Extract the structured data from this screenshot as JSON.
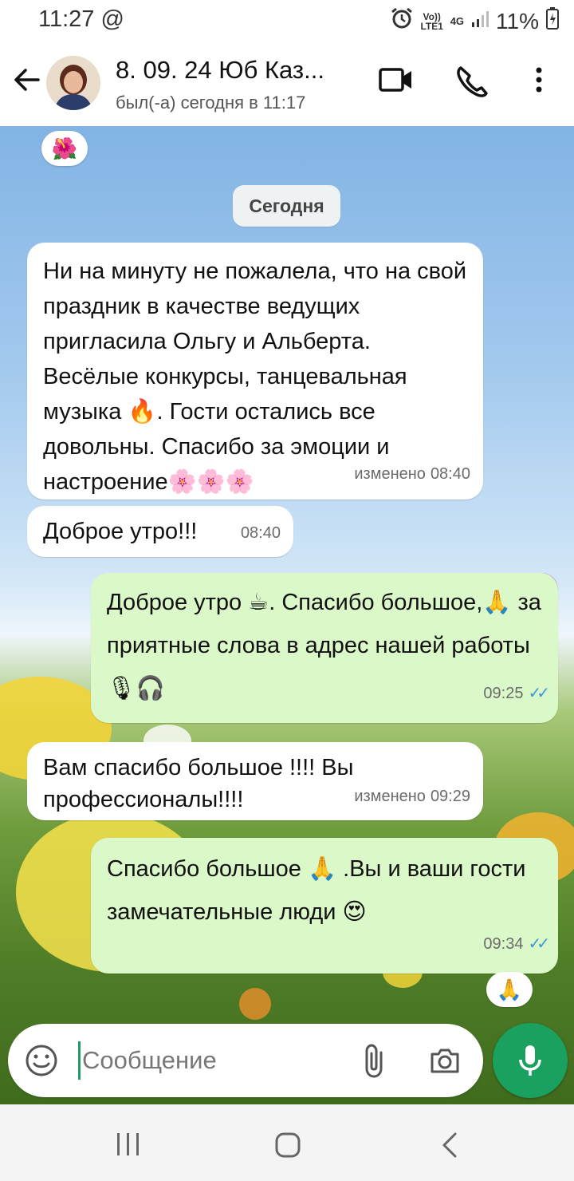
{
  "status_bar": {
    "time": "11:27",
    "at_symbol": "@",
    "volte": "Vo)) LTE1",
    "network": "4G",
    "battery": "11%"
  },
  "header": {
    "title": "8. 09. 24 Юб Каз...",
    "subtitle": "был(-а) сегодня в 11:17",
    "icons": [
      "back-arrow-icon",
      "video-call-icon",
      "phone-icon",
      "more-vert-icon"
    ]
  },
  "chat": {
    "top_reaction": "🌺",
    "day_chip": "Сегодня",
    "messages": [
      {
        "direction": "incoming",
        "text": "Ни на минуту не пожалела, что на свой праздник в качестве ведущих пригласила Ольгу и Альберта. Весёлые конкурсы, танцевальная музыка 🔥. Гости остались все довольны. Спасибо за эмоции и настроение🌸🌸🌸",
        "edited": "изменено",
        "time": "08:40"
      },
      {
        "direction": "incoming",
        "text": "Доброе утро!!!",
        "edited": "",
        "time": "08:40"
      },
      {
        "direction": "outgoing",
        "text": "Доброе утро ☕. Спасибо большое,🙏 за приятные слова в адрес нашей работы 🎙🎧",
        "edited": "",
        "time": "09:25",
        "read": true
      },
      {
        "direction": "incoming",
        "text": "Вам спасибо большое !!!! Вы профессионалы!!!!",
        "edited": "изменено",
        "time": "09:29"
      },
      {
        "direction": "outgoing",
        "text": "Спасибо большое 🙏 .Вы и ваши гости замечательные люди 😍",
        "edited": "",
        "time": "09:34",
        "read": true
      }
    ],
    "last_reaction": "🙏"
  },
  "input": {
    "placeholder": "Сообщение"
  },
  "colors": {
    "accent": "#1aa15f",
    "outgoing_bubble": "#dbf8c8",
    "read_ticks": "#3b97d8"
  }
}
